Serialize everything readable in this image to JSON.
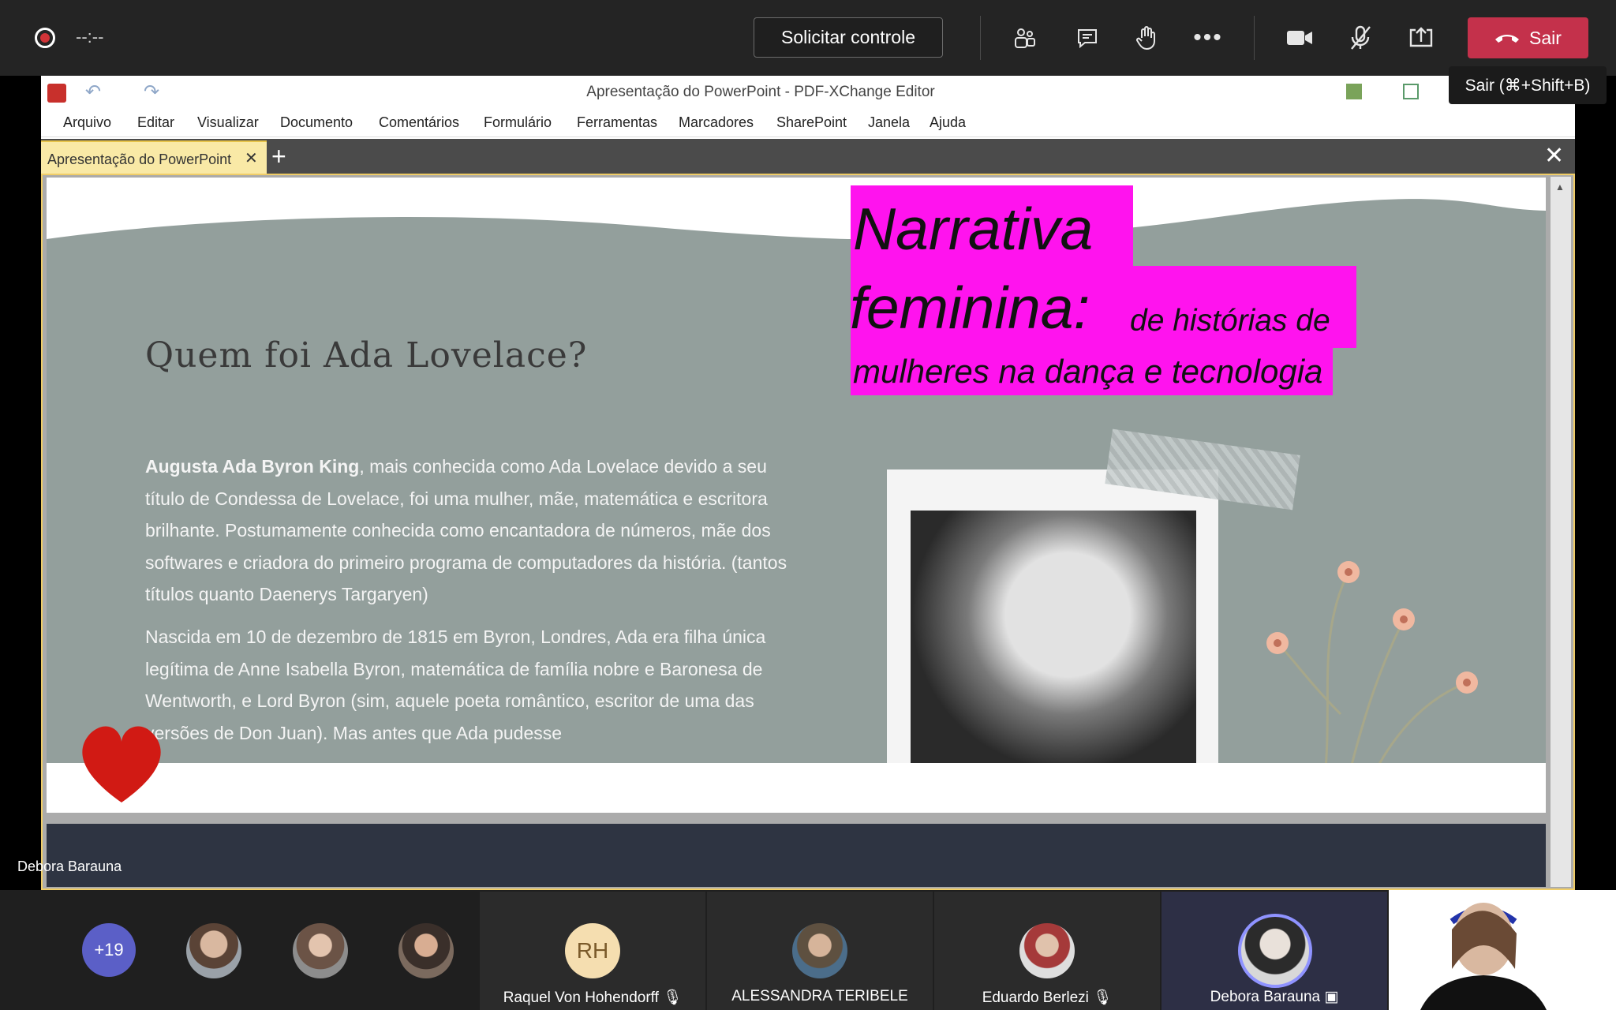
{
  "teams": {
    "timer": "--:--",
    "request_control_label": "Solicitar controle",
    "leave_label": "Sair",
    "tooltip": "Sair (⌘+Shift+B)",
    "presenter_label": "Debora Barauna"
  },
  "window": {
    "title": "Apresentação do PowerPoint - PDF-XChange Editor",
    "menu": [
      "Arquivo",
      "Editar",
      "Visualizar",
      "Documento",
      "Comentários",
      "Formulário",
      "Ferramentas",
      "Marcadores",
      "SharePoint",
      "Janela",
      "Ajuda"
    ],
    "tab_label": "Apresentação do PowerPoint",
    "new_tab": "+",
    "close_glyph": "✕"
  },
  "slide": {
    "heading": "Quem foi Ada Lovelace?",
    "title_line1": "Narrativa",
    "title_line2": "feminina:",
    "title_small1": "de histórias de",
    "title_small2": "mulheres na dança e tecnologia",
    "para1_name": "Augusta Ada Byron King",
    "para1_rest": ", mais conhecida como Ada Lovelace devido a seu título de Condessa de Lovelace, foi uma mulher, mãe, matemática e escritora brilhante. Postumamente conhecida como encantadora de números, mãe dos softwares e criadora do primeiro programa de computadores da história. (tantos títulos quanto Daenerys Targaryen)",
    "para2": "Nascida em 10 de dezembro de 1815 em Byron, Londres, Ada era filha única legítima de Anne Isabella Byron, matemática de família nobre  e Baronesa de Wentworth, e Lord Byron (sim, aquele poeta romântico, escritor de uma das versões de Don Juan). Mas antes que Ada pudesse"
  },
  "participants": {
    "more_count": "+19",
    "tiles": [
      {
        "initials": "RH",
        "name": "Raquel Von Hohendorff"
      },
      {
        "name": "ALESSANDRA TERIBELE"
      },
      {
        "name": "Eduardo Berlezi"
      },
      {
        "name": "Debora Barauna"
      }
    ]
  }
}
